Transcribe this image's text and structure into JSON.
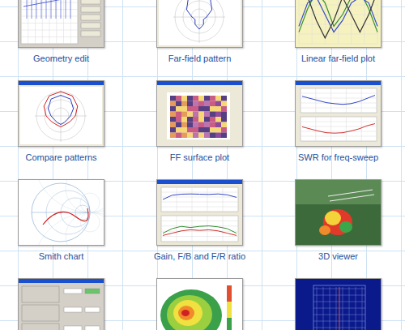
{
  "tiles": [
    {
      "caption": "Geometry edit",
      "kind": "geometry"
    },
    {
      "caption": "Far-field pattern",
      "kind": "polar",
      "series": [
        {
          "color": "#2a3fc0",
          "values": [
            1,
            0.9,
            0.6,
            0.3,
            0.2,
            0.35,
            0.5,
            0.35,
            0.2,
            0.3,
            0.6,
            0.9
          ]
        }
      ]
    },
    {
      "caption": "Linear far-field plot",
      "kind": "linear",
      "series": [
        {
          "color": "#2f8f2f",
          "values": [
            2,
            6,
            9,
            7,
            3,
            5,
            8,
            9,
            6,
            2
          ]
        },
        {
          "color": "#3448c8",
          "values": [
            3,
            7,
            8,
            5,
            2,
            4,
            7,
            8,
            7,
            3
          ]
        },
        {
          "color": "#333333",
          "values": [
            9,
            8,
            4,
            1,
            4,
            8,
            5,
            2,
            5,
            9
          ]
        }
      ]
    },
    {
      "caption": "Compare patterns",
      "kind": "polar",
      "series": [
        {
          "color": "#d02020",
          "values": [
            1,
            0.95,
            0.8,
            0.6,
            0.45,
            0.4,
            0.45,
            0.4,
            0.45,
            0.6,
            0.8,
            0.95
          ]
        },
        {
          "color": "#2a3fc0",
          "values": [
            0.85,
            0.8,
            0.6,
            0.4,
            0.3,
            0.3,
            0.35,
            0.3,
            0.3,
            0.4,
            0.6,
            0.8
          ]
        }
      ]
    },
    {
      "caption": "FF surface plot",
      "kind": "surface"
    },
    {
      "caption": "SWR for freq-sweep",
      "kind": "swr",
      "series": [
        {
          "color": "#3448c8",
          "values": [
            7,
            6,
            5,
            4,
            3.5,
            3.2,
            3.5,
            4.5,
            6,
            7.5
          ]
        },
        {
          "color": "#d03030",
          "values": [
            6,
            5,
            4,
            3.2,
            3,
            3.2,
            4,
            5,
            6.5,
            7.5
          ]
        }
      ]
    },
    {
      "caption": "Smith chart",
      "kind": "smith"
    },
    {
      "caption": "Gain, F/B and F/R ratio",
      "kind": "gain",
      "series": [
        {
          "color": "#3448c8",
          "values": [
            5,
            7,
            7.5,
            7.6,
            7.5,
            7.4,
            7.6,
            7.2,
            6
          ]
        },
        {
          "color": "#2f8f2f",
          "values": [
            3,
            5,
            6,
            5.5,
            6,
            6.2,
            5.8,
            5,
            3
          ]
        },
        {
          "color": "#d03030",
          "values": [
            2,
            3,
            4,
            4.5,
            4.2,
            4.5,
            4,
            3,
            2
          ]
        }
      ]
    },
    {
      "caption": "3D viewer",
      "kind": "viewer3d"
    },
    {
      "kind": "dialog"
    },
    {
      "kind": "heatmap"
    },
    {
      "kind": "structure"
    }
  ]
}
